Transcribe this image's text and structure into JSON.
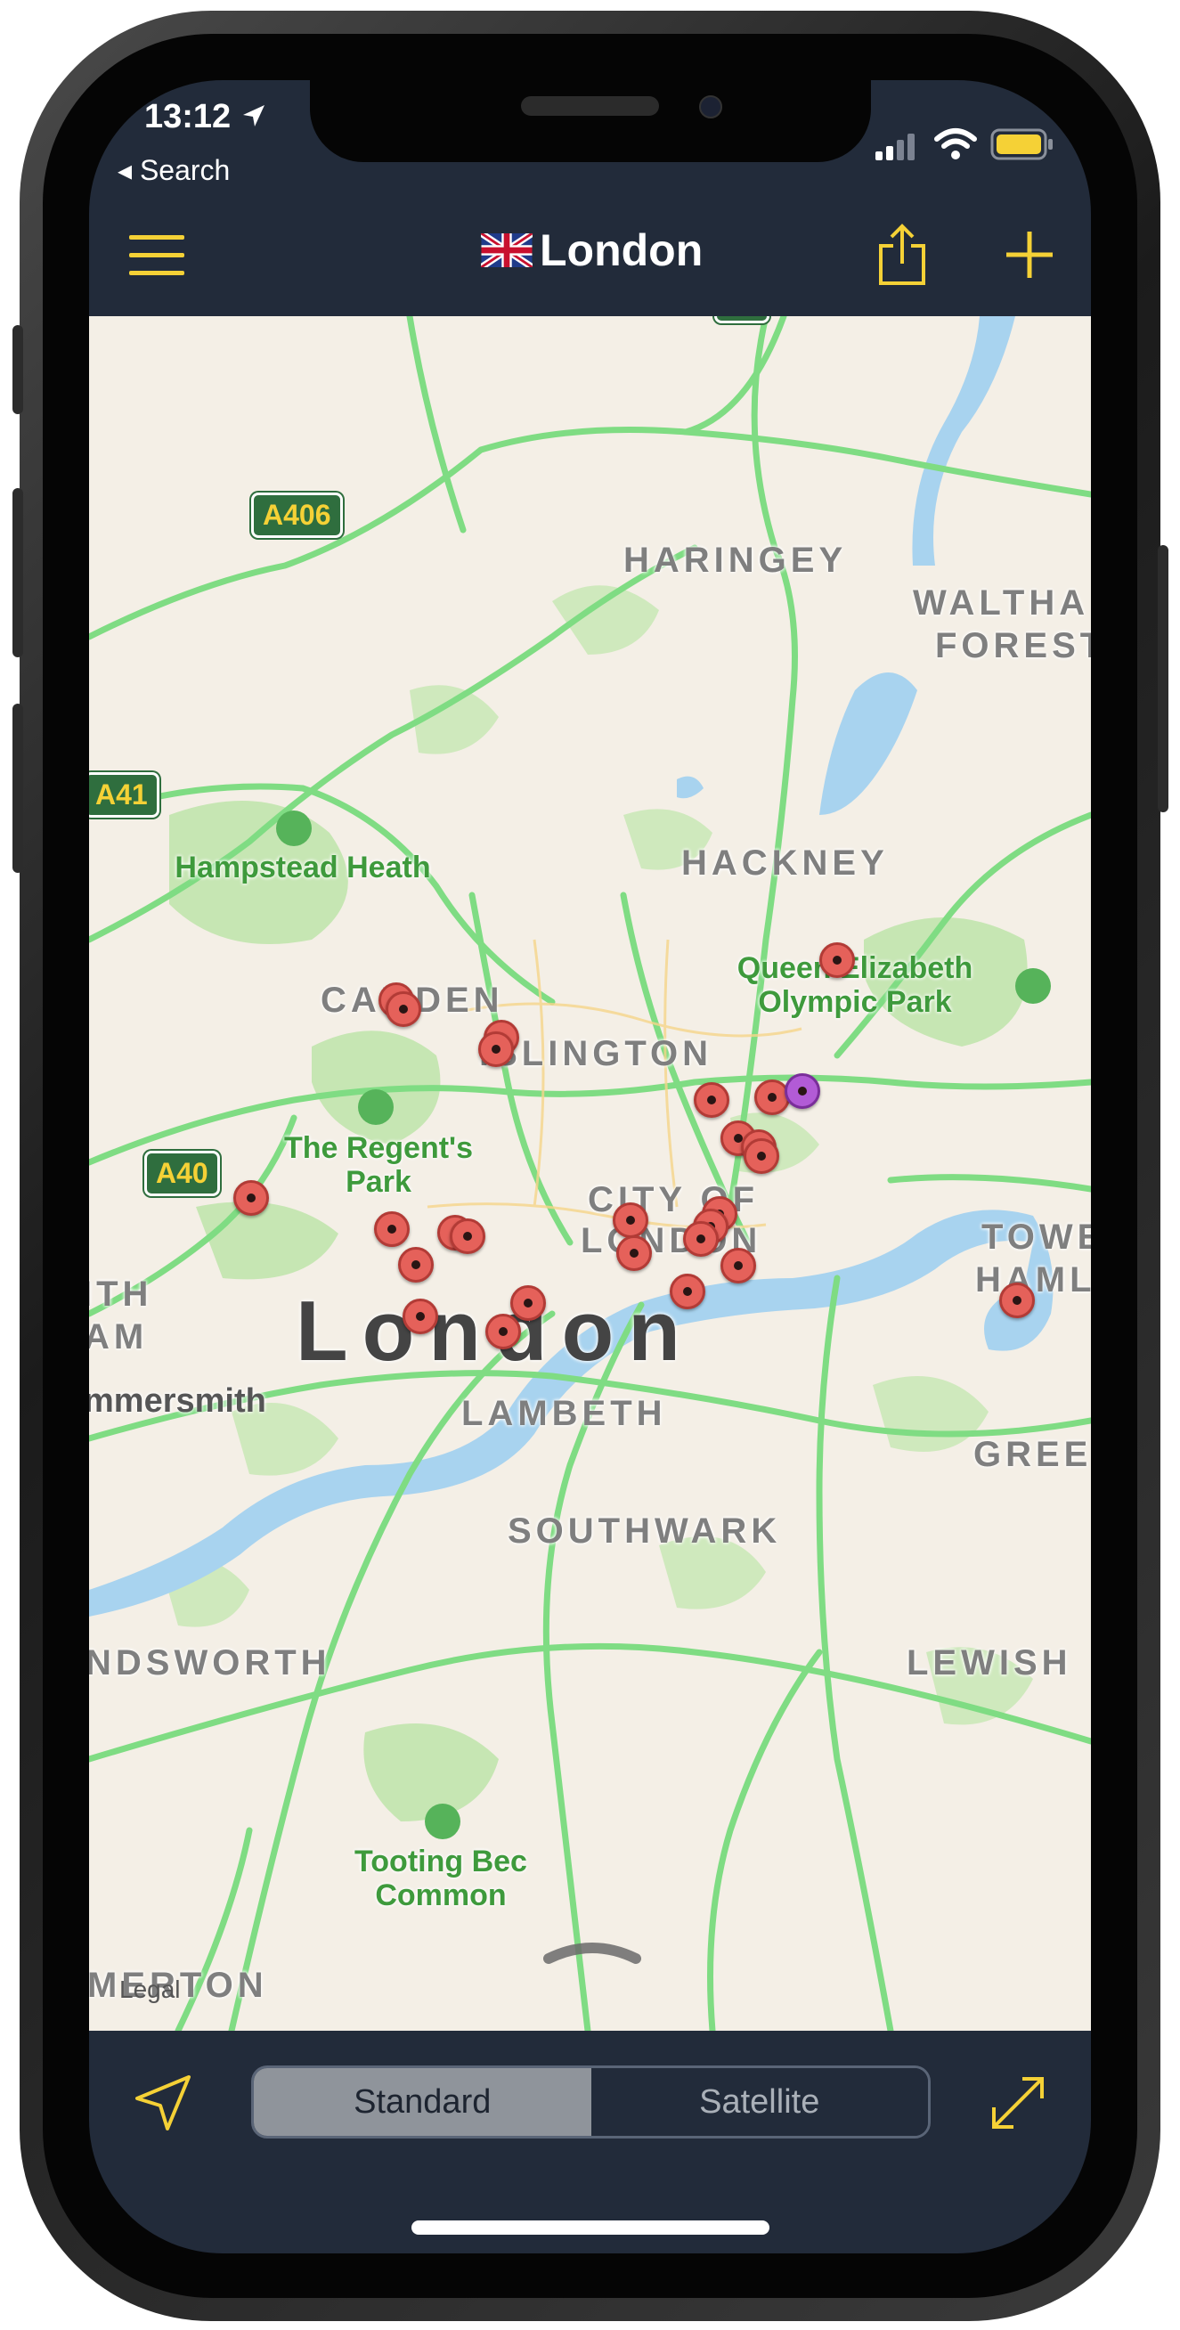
{
  "status_bar": {
    "time": "13:12",
    "back_label": "◂ Search"
  },
  "nav": {
    "title": "London",
    "flag": "UK flag",
    "menu_icon": "menu-icon",
    "share_icon": "share-icon",
    "add_icon": "plus-icon"
  },
  "map": {
    "city_label": "London",
    "districts": [
      "HARINGEY",
      "WALTHA",
      "FOREST",
      "HACKNEY",
      "CAMDEN",
      "ISLINGTON",
      "CITY OF",
      "LONDON",
      "TOWE",
      "HAMLE",
      "LAMBETH",
      "SOUTHWARK",
      "GREE",
      "LEWISH",
      "NDSWORTH",
      "MERTON",
      "ITH",
      "AM",
      "mmersmith"
    ],
    "parks": [
      "Hampstead Heath",
      "Queen Elizabeth Olympic Park",
      "The Regent's Park",
      "Tooting Bec Common"
    ],
    "road_signs": [
      "A406",
      "A41",
      "A40"
    ],
    "legal": "Legal",
    "pins_count": 27
  },
  "bottom_bar": {
    "locate_icon": "location-arrow-icon",
    "segments": [
      "Standard",
      "Satellite"
    ],
    "selected_segment": "Standard",
    "expand_icon": "expand-icon"
  },
  "colors": {
    "nav_bg": "#222b3a",
    "accent": "#f5d136",
    "pin": "#e5615a",
    "purple_pin": "#b25bd6",
    "road": "#7fdc83"
  }
}
